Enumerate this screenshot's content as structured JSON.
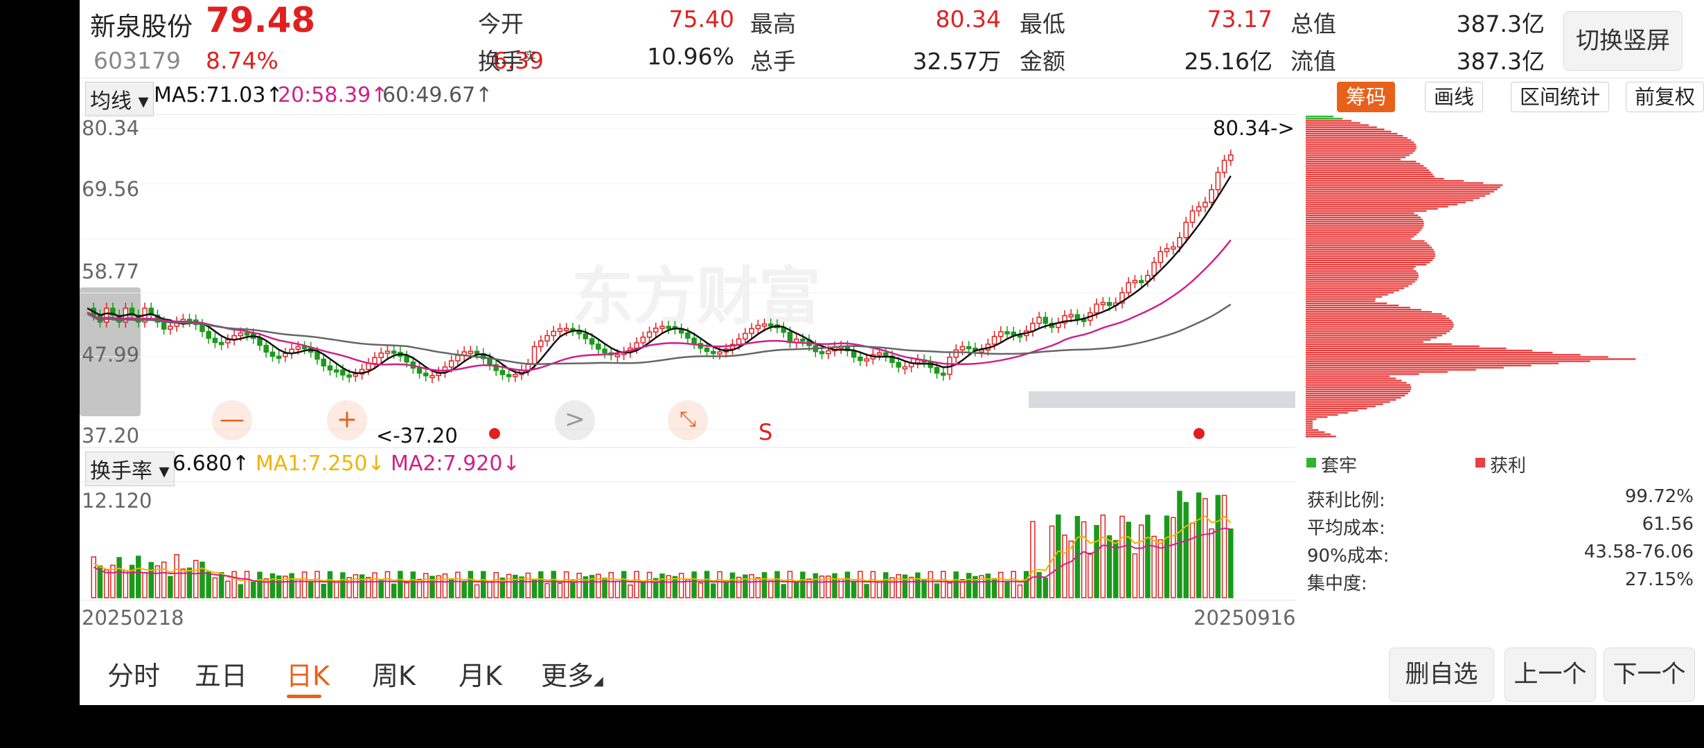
{
  "stock": {
    "name": "新泉股份",
    "price": "79.48",
    "code": "603179",
    "change_pct": "8.74%",
    "change": "6.39"
  },
  "quote": {
    "open_label": "今开",
    "open": "75.40",
    "high_label": "最高",
    "high": "80.34",
    "low_label": "最低",
    "low": "73.17",
    "total_cap_label": "总值",
    "total_cap": "387.3亿",
    "turnover_label": "换手",
    "turnover_sup": "实",
    "turnover": "10.96%",
    "volume_label": "总手",
    "volume": "32.57万",
    "amount_label": "金额",
    "amount": "25.16亿",
    "float_cap_label": "流值",
    "float_cap": "387.3亿"
  },
  "toolbar": {
    "switch_label": "切换竖屏",
    "ma_dropdown": "均线",
    "ma5": "MA5:71.03↑",
    "ma20": "20:58.39↑",
    "ma60": "60:49.67↑",
    "chips_label": "筹码",
    "draw_label": "画线",
    "range_stats_label": "区间统计",
    "adjust_label": "前复权"
  },
  "price_chart": {
    "y_labels": [
      "80.34",
      "69.56",
      "58.77",
      "47.99",
      "37.20"
    ],
    "max_annotation": "80.34->",
    "min_annotation": "<-37.20",
    "watermark": "东方财富",
    "signal_label": "S",
    "tool_minus": "—",
    "tool_plus": "+",
    "tool_next": ">",
    "colors": {
      "up": "#e02020",
      "down": "#1a9a1a",
      "ma5": "#111111",
      "ma20": "#d0208a",
      "ma60": "#666666"
    }
  },
  "turnover_panel": {
    "dropdown": "换手率",
    "value": "6.680↑",
    "ma1": "MA1:7.250↓",
    "ma2": "MA2:7.920↓",
    "y_max": "12.120",
    "date_start": "20250218",
    "date_end": "20250916",
    "colors": {
      "ma1": "#f0b400",
      "ma2": "#d0208a"
    }
  },
  "chips": {
    "legend_trapped": "套牢",
    "legend_profit": "获利",
    "stats": [
      {
        "label": "获利比例:",
        "value": "99.72%"
      },
      {
        "label": "平均成本:",
        "value": "61.56"
      },
      {
        "label": "90%成本:",
        "value": "43.58-76.06"
      },
      {
        "label": "集中度:",
        "value": "27.15%"
      }
    ]
  },
  "tabs": [
    "分时",
    "五日",
    "日K",
    "周K",
    "月K",
    "更多"
  ],
  "active_tab": "日K",
  "buttons": {
    "remove_watch": "删自选",
    "prev": "上一个",
    "next": "下一个"
  }
}
